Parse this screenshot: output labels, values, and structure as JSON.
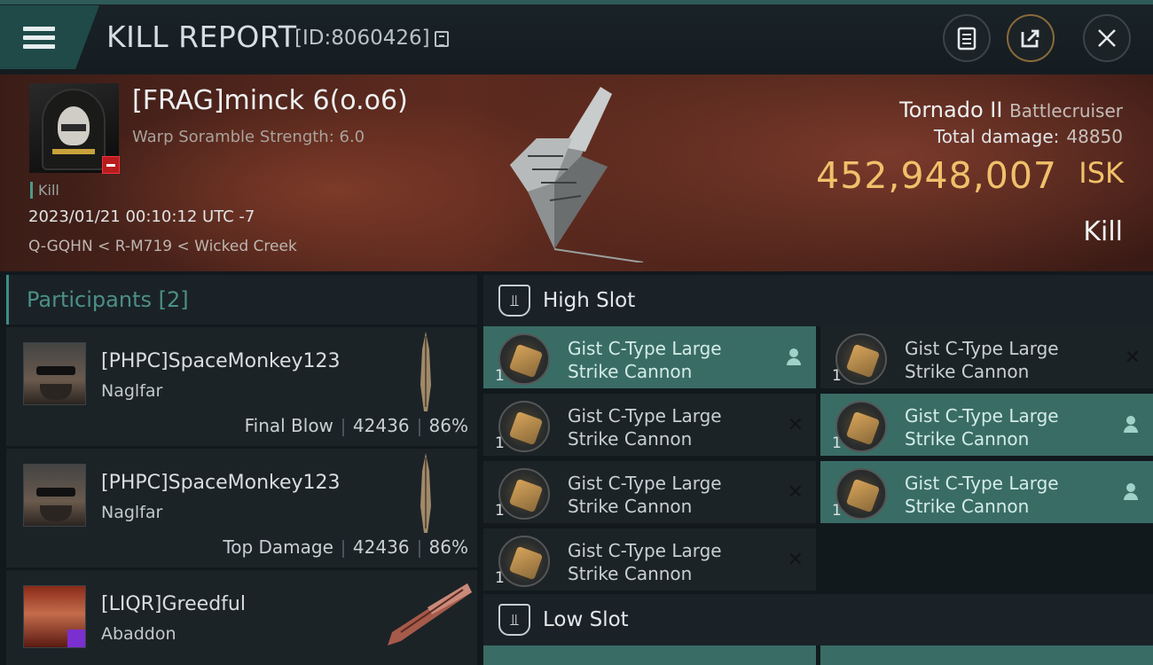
{
  "header": {
    "title": "KILL REPORT",
    "report_id": "[ID:8060426]"
  },
  "victim": {
    "name": "[FRAG]minck 6(o.o6)",
    "warp": "Warp Soramble Strength: 6.0",
    "tag": "Kill",
    "datetime": "2023/01/21 00:10:12 UTC -7",
    "location": "Q-GQHN < R-M719 < Wicked Creek",
    "ship": "Tornado II",
    "ship_class": "Battlecruiser",
    "total_damage_label": "Total damage:",
    "total_damage": "48850",
    "isk_value": "452,948,007",
    "isk_unit": "ISK",
    "result": "Kill"
  },
  "participants": {
    "label": "Participants",
    "count": "[2]",
    "rows": [
      {
        "name": "[PHPC]SpaceMonkey123",
        "ship": "Naglfar",
        "role": "Final Blow",
        "damage": "42436",
        "percent": "86%"
      },
      {
        "name": "[PHPC]SpaceMonkey123",
        "ship": "Naglfar",
        "role": "Top Damage",
        "damage": "42436",
        "percent": "86%"
      },
      {
        "name": "[LIQR]Greedful",
        "ship": "Abaddon"
      }
    ]
  },
  "slots": {
    "high_label": "High Slot",
    "low_label": "Low Slot",
    "modules": [
      {
        "line1": "Gist C-Type Large",
        "line2": "Strike Cannon",
        "qty": "1",
        "state": "dropped"
      },
      {
        "line1": "Gist C-Type Large",
        "line2": "Strike Cannon",
        "qty": "1",
        "state": "destroyed"
      },
      {
        "line1": "Gist C-Type Large",
        "line2": "Strike Cannon",
        "qty": "1",
        "state": "destroyed"
      },
      {
        "line1": "Gist C-Type Large",
        "line2": "Strike Cannon",
        "qty": "1",
        "state": "dropped"
      },
      {
        "line1": "Gist C-Type Large",
        "line2": "Strike Cannon",
        "qty": "1",
        "state": "destroyed"
      },
      {
        "line1": "Gist C-Type Large",
        "line2": "Strike Cannon",
        "qty": "1",
        "state": "dropped"
      },
      {
        "line1": "Gist C-Type Large",
        "line2": "Strike Cannon",
        "qty": "1",
        "state": "destroyed"
      }
    ]
  },
  "icons": {
    "menu": "hamburger-icon",
    "copy": "copy-icon",
    "clipboard": "clipboard-icon",
    "share": "share-icon",
    "close": "close-icon",
    "slot": "slot-icon",
    "person": "person-icon",
    "destroyed": "x-icon"
  },
  "colors": {
    "accent_teal": "#3a6c66",
    "isk_gold": "#f0c06a",
    "danger_red": "#b81c1c"
  }
}
